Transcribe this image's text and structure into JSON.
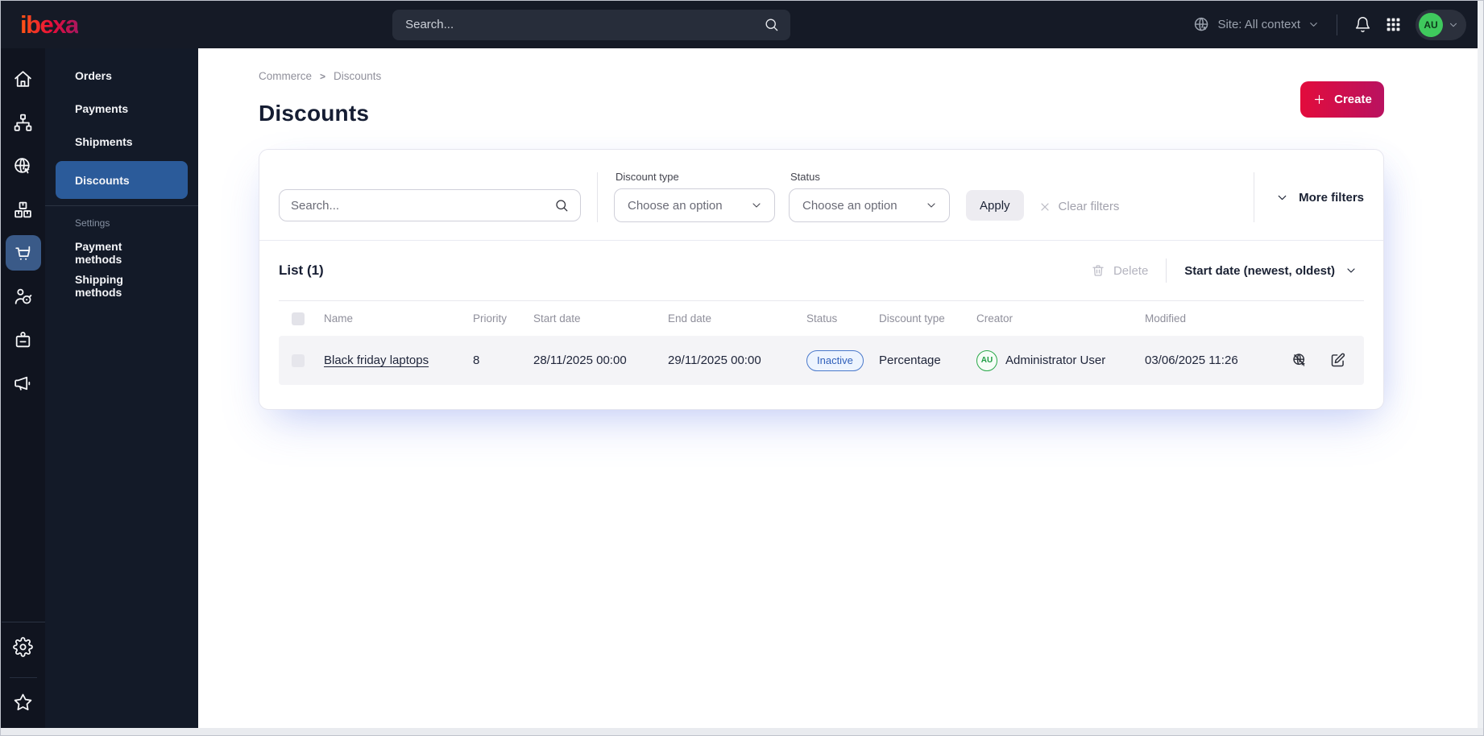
{
  "topbar": {
    "logo": "ibexa",
    "search_placeholder": "Search...",
    "site_context": "Site: All context",
    "user_initials": "AU",
    "icons": [
      "site-globe-icon",
      "chevron-down-icon",
      "bell-icon",
      "app-grid-icon",
      "avatar",
      "chevron-down-icon"
    ]
  },
  "icon_rail": {
    "items": [
      "home",
      "content-tree",
      "site",
      "products",
      "commerce",
      "customers",
      "jobs",
      "marketing"
    ],
    "active_item": "commerce",
    "bottom_items": [
      "settings-gear",
      "bookmarks-star"
    ]
  },
  "sidebar": {
    "items": [
      {
        "label": "Orders"
      },
      {
        "label": "Payments"
      },
      {
        "label": "Shipments"
      },
      {
        "label": "Discounts",
        "active": true
      }
    ],
    "settings_heading": "Settings",
    "settings_items": [
      {
        "label": "Payment methods"
      },
      {
        "label": "Shipping methods"
      }
    ]
  },
  "breadcrumb": {
    "items": [
      "Commerce",
      "Discounts"
    ],
    "separator": ">"
  },
  "page": {
    "title": "Discounts",
    "create_label": "Create"
  },
  "filters": {
    "search_placeholder": "Search...",
    "discount_type_label": "Discount type",
    "discount_type_value": "Choose an option",
    "status_label": "Status",
    "status_value": "Choose an option",
    "apply_label": "Apply",
    "clear_label": "Clear filters",
    "more_label": "More filters"
  },
  "list": {
    "title": "List (1)",
    "delete_label": "Delete",
    "sort_label": "Start date (newest, oldest)",
    "columns": [
      "Name",
      "Priority",
      "Start date",
      "End date",
      "Status",
      "Discount type",
      "Creator",
      "Modified"
    ],
    "rows": [
      {
        "name": "Black friday laptops",
        "priority": "8",
        "start_date": "28/11/2025 00:00",
        "end_date": "29/11/2025 00:00",
        "status": "Inactive",
        "discount_type": "Percentage",
        "creator_initials": "AU",
        "creator": "Administrator User",
        "modified": "03/06/2025 11:26",
        "row_icons": [
          "site-visibility-disabled-icon",
          "edit-icon"
        ]
      }
    ]
  },
  "colors": {
    "topbar_bg": "#151a26",
    "rail_bg": "#10141f",
    "menu_bg": "#131a28",
    "active_menu_blue": "#2b5b9a",
    "active_rail_blue": "#3a5a88",
    "brand_gradient_start": "#e20c3c",
    "brand_gradient_end": "#b91260",
    "status_inactive_blue": "#3060ba",
    "avatar_green": "#3fc95d",
    "row_bg": "#f4f4f7"
  }
}
